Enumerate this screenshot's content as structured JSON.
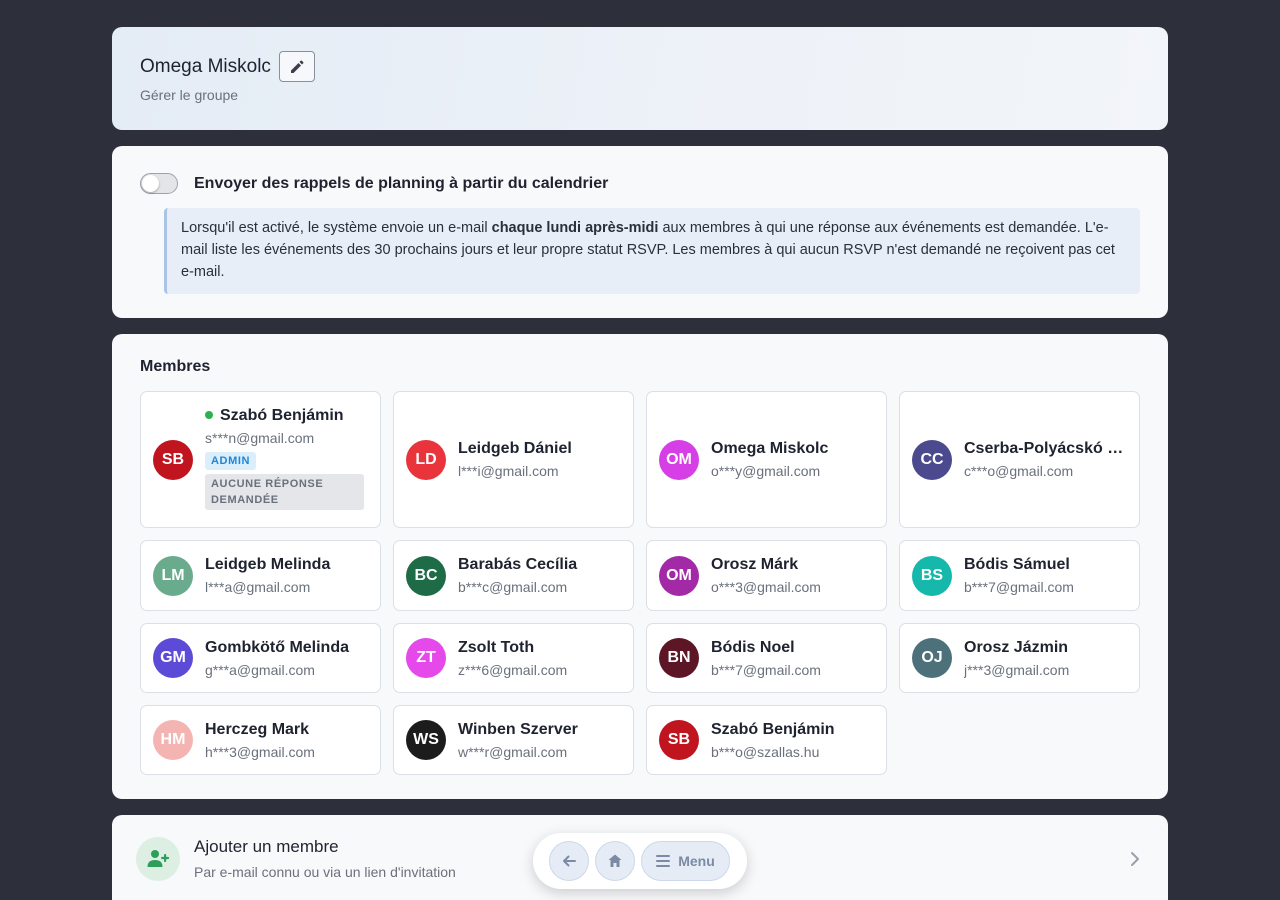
{
  "header": {
    "title": "Omega Miskolc",
    "subtitle": "Gérer le groupe"
  },
  "reminder": {
    "enabled": false,
    "label": "Envoyer des rappels de planning à partir du calendrier",
    "info_part1": "Lorsqu'il est activé, le système envoie un e-mail ",
    "info_bold": "chaque lundi après-midi",
    "info_part2": " aux membres à qui une réponse aux événements est demandée. L'e-mail liste les événements des 30 prochains jours et leur propre statut RSVP. Les membres à qui aucun RSVP n'est demandé ne reçoivent pas cet e-mail."
  },
  "members": {
    "title": "Membres",
    "items": [
      {
        "initials": "SB",
        "name": "Szabó Benjámin",
        "email": "s***n@gmail.com",
        "color": "#c0141f",
        "online": true,
        "admin_badge": "ADMIN",
        "rsvp_badge": "AUCUNE RÉPONSE DEMANDÉE"
      },
      {
        "initials": "LD",
        "name": "Leidgeb Dániel",
        "email": "l***i@gmail.com",
        "color": "#e8343a"
      },
      {
        "initials": "OM",
        "name": "Omega Miskolc",
        "email": "o***y@gmail.com",
        "color": "#d63fe6"
      },
      {
        "initials": "CC",
        "name": "Cserba-Polyácskó Csaba",
        "email": "c***o@gmail.com",
        "color": "#4b4a8e"
      },
      {
        "initials": "LM",
        "name": "Leidgeb Melinda",
        "email": "l***a@gmail.com",
        "color": "#6aab8e"
      },
      {
        "initials": "BC",
        "name": "Barabás Cecília",
        "email": "b***c@gmail.com",
        "color": "#1e6b47"
      },
      {
        "initials": "OM",
        "name": "Orosz Márk",
        "email": "o***3@gmail.com",
        "color": "#a22aa6"
      },
      {
        "initials": "BS",
        "name": "Bódis Sámuel",
        "email": "b***7@gmail.com",
        "color": "#15b8aa"
      },
      {
        "initials": "GM",
        "name": "Gombkötő Melinda",
        "email": "g***a@gmail.com",
        "color": "#5b4bd6"
      },
      {
        "initials": "ZT",
        "name": "Zsolt Toth",
        "email": "z***6@gmail.com",
        "color": "#e649ea"
      },
      {
        "initials": "BN",
        "name": "Bódis Noel",
        "email": "b***7@gmail.com",
        "color": "#5c1626"
      },
      {
        "initials": "OJ",
        "name": "Orosz Jázmin",
        "email": "j***3@gmail.com",
        "color": "#4d717a"
      },
      {
        "initials": "HM",
        "name": "Herczeg Mark",
        "email": "h***3@gmail.com",
        "color": "#f4b5b2"
      },
      {
        "initials": "WS",
        "name": "Winben Szerver",
        "email": "w***r@gmail.com",
        "color": "#1c1c1c"
      },
      {
        "initials": "SB",
        "name": "Szabó Benjámin",
        "email": "b***o@szallas.hu",
        "color": "#c0141f"
      }
    ]
  },
  "add_member": {
    "title": "Ajouter un membre",
    "subtitle": "Par e-mail connu ou via un lien d'invitation"
  },
  "nav": {
    "menu_label": "Menu"
  },
  "colors": {
    "accent": "#1f86d6",
    "online": "#2bb24c",
    "background": "#2d303b"
  }
}
